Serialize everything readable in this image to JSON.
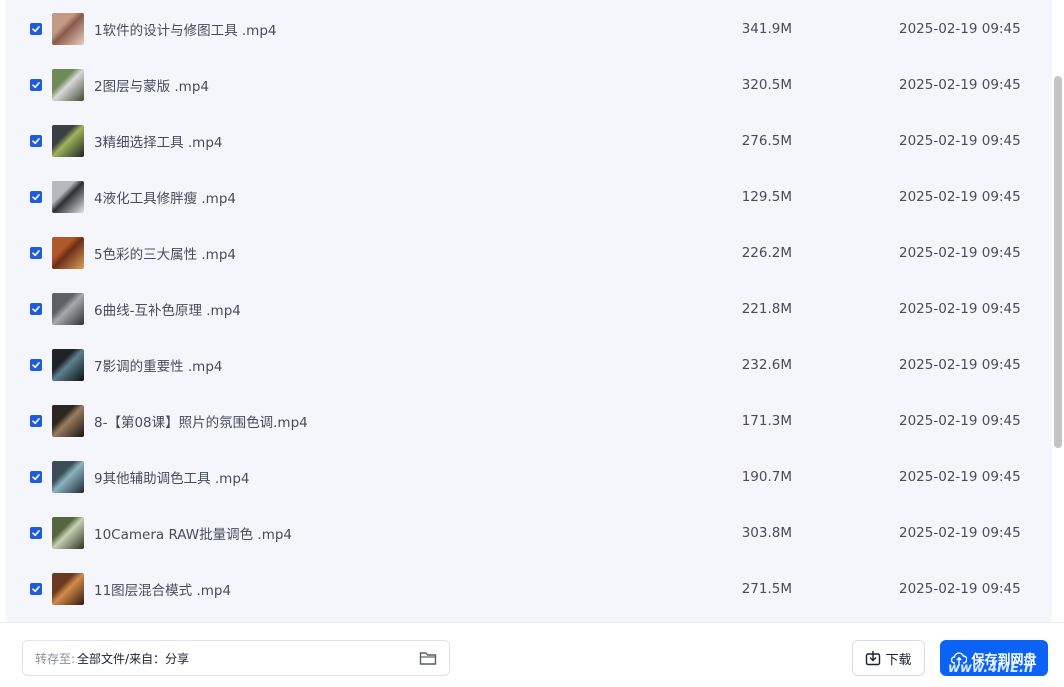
{
  "files": [
    {
      "name": "1软件的设计与修图工具 .mp4",
      "size": "341.9M",
      "date": "2025-02-19 09:45",
      "checked": true,
      "thumb": [
        "#c49a86",
        "#8a5a4a",
        "#e8cfc0"
      ]
    },
    {
      "name": "2图层与蒙版 .mp4",
      "size": "320.5M",
      "date": "2025-02-19 09:45",
      "checked": true,
      "thumb": [
        "#6f8a5a",
        "#d9d9d9",
        "#3b4a30"
      ]
    },
    {
      "name": "3精细选择工具 .mp4",
      "size": "276.5M",
      "date": "2025-02-19 09:45",
      "checked": true,
      "thumb": [
        "#3a3f45",
        "#9fb35a",
        "#1d2126"
      ]
    },
    {
      "name": "4液化工具修胖瘦 .mp4",
      "size": "129.5M",
      "date": "2025-02-19 09:45",
      "checked": true,
      "thumb": [
        "#b7b9bd",
        "#2c2f33",
        "#e7e7e7"
      ]
    },
    {
      "name": "5色彩的三大属性 .mp4",
      "size": "226.2M",
      "date": "2025-02-19 09:45",
      "checked": true,
      "thumb": [
        "#b0572c",
        "#6a2e17",
        "#e0a060"
      ]
    },
    {
      "name": "6曲线-互补色原理 .mp4",
      "size": "221.8M",
      "date": "2025-02-19 09:45",
      "checked": true,
      "thumb": [
        "#5d6166",
        "#a8a9ab",
        "#2d3035"
      ]
    },
    {
      "name": "7影调的重要性 .mp4",
      "size": "232.6M",
      "date": "2025-02-19 09:45",
      "checked": true,
      "thumb": [
        "#1f2328",
        "#5c7f8f",
        "#0e1013"
      ]
    },
    {
      "name": "8-【第08课】照片的氛围色调.mp4",
      "size": "171.3M",
      "date": "2025-02-19 09:45",
      "checked": true,
      "thumb": [
        "#2b2622",
        "#9a7c5e",
        "#171412"
      ]
    },
    {
      "name": "9其他辅助调色工具 .mp4",
      "size": "190.7M",
      "date": "2025-02-19 09:45",
      "checked": true,
      "thumb": [
        "#3b4d57",
        "#8cb3c2",
        "#1e272c"
      ]
    },
    {
      "name": "10Camera RAW批量调色 .mp4",
      "size": "303.8M",
      "date": "2025-02-19 09:45",
      "checked": true,
      "thumb": [
        "#55663f",
        "#c7cfb4",
        "#2a331f"
      ]
    },
    {
      "name": "11图层混合模式 .mp4",
      "size": "271.5M",
      "date": "2025-02-19 09:45",
      "checked": true,
      "thumb": [
        "#6b3a22",
        "#d48a4a",
        "#2e1a10"
      ]
    }
  ],
  "footer": {
    "save_label": "转存至:",
    "save_value": "全部文件/来自：分享",
    "download_label": "下载",
    "save_button_label": "保存到网盘"
  },
  "watermark": "www.4ME.n",
  "colors": {
    "accent": "#0b63f6",
    "checkbox": "#1f5bde",
    "list_bg": "#f5f6fc"
  }
}
